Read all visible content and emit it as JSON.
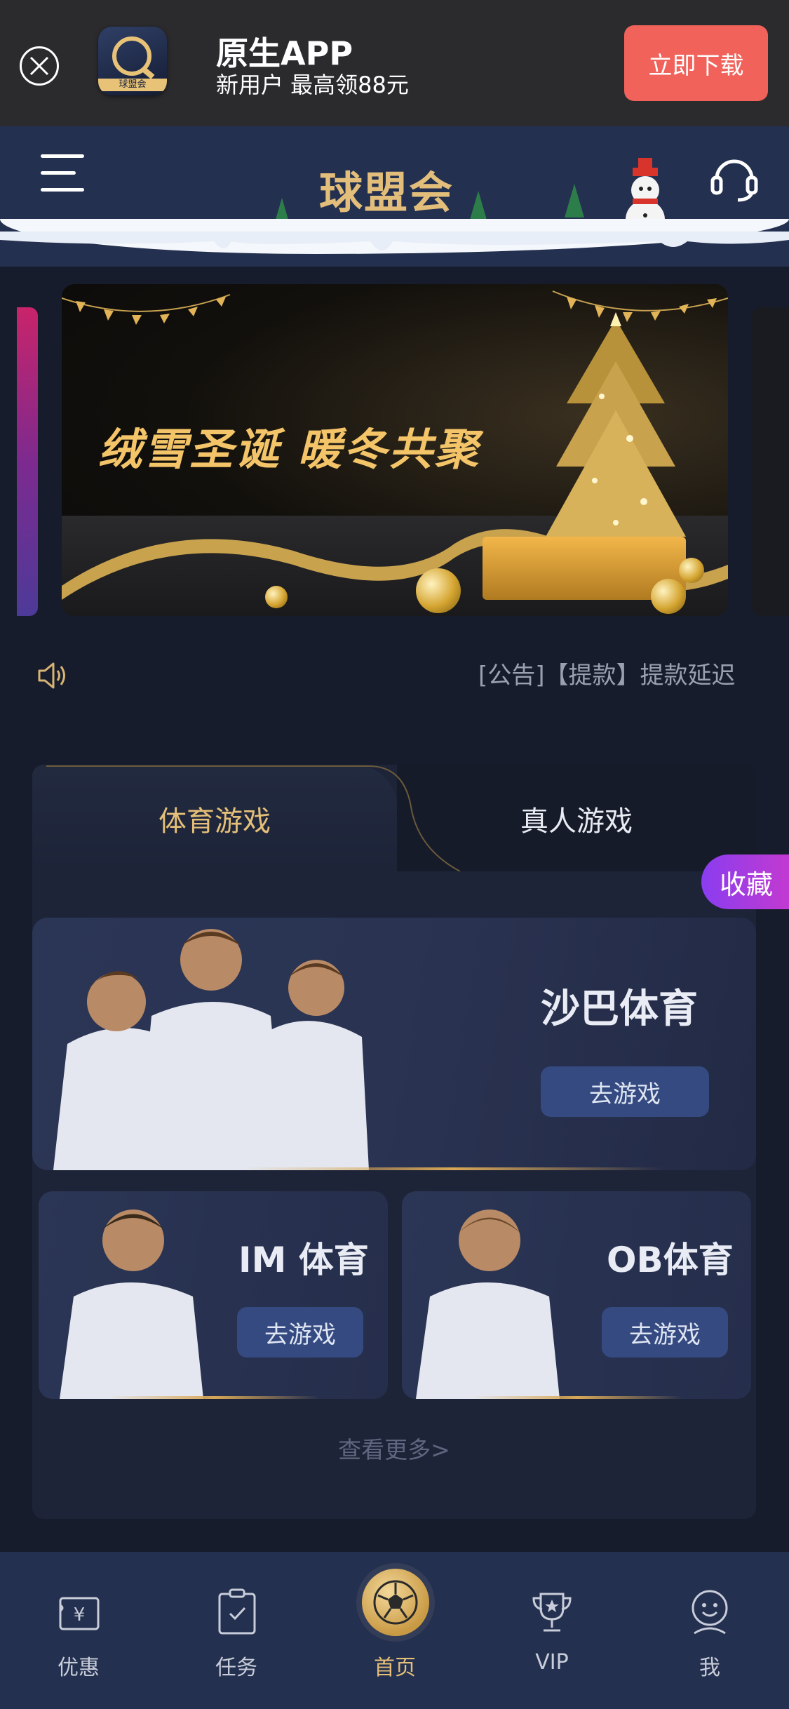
{
  "app_banner": {
    "title": "原生APP",
    "subtitle": "新用户 最高领88元",
    "download_label": "立即下载",
    "logo_text": "球盟会"
  },
  "header": {
    "logo_text": "球盟会",
    "menu_icon": "hamburger-icon",
    "support_icon": "headset-icon"
  },
  "banner": {
    "headline": "绒雪圣诞  暖冬共聚"
  },
  "notice": {
    "text": "[公告]【提款】提款延迟"
  },
  "games": {
    "tabs": [
      {
        "label": "体育游戏",
        "active": true
      },
      {
        "label": "真人游戏",
        "active": false
      }
    ],
    "favorite_label": "收藏",
    "featured": {
      "title": "沙巴体育",
      "button": "去游戏"
    },
    "cards": [
      {
        "title": "IM 体育",
        "button": "去游戏"
      },
      {
        "title": "OB体育",
        "button": "去游戏"
      }
    ],
    "more_label": "查看更多>"
  },
  "bottom_nav": [
    {
      "label": "优惠",
      "icon": "coupon-icon",
      "active": false
    },
    {
      "label": "任务",
      "icon": "clipboard-icon",
      "active": false
    },
    {
      "label": "首页",
      "icon": "soccer-ball-icon",
      "active": true
    },
    {
      "label": "VIP",
      "icon": "trophy-icon",
      "active": false
    },
    {
      "label": "我",
      "icon": "smiley-icon",
      "active": false
    }
  ],
  "colors": {
    "background": "#171c2c",
    "gold_accent": "#e4bf78",
    "download_button": "#f0625a",
    "favorite_gradient_start": "#8a3df0",
    "favorite_gradient_end": "#c23ad0"
  }
}
